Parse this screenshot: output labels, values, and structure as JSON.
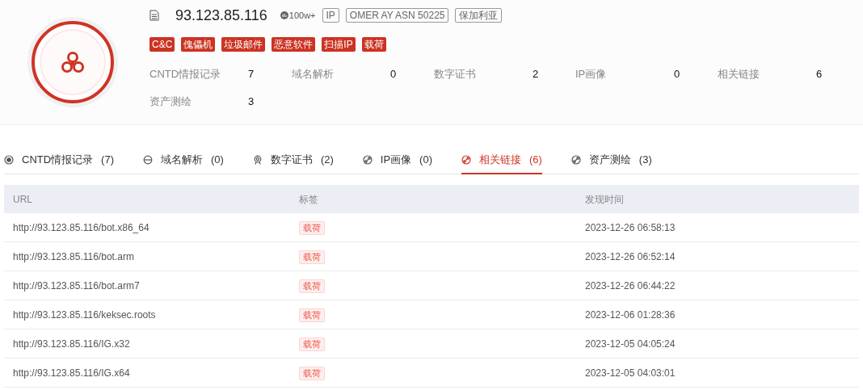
{
  "header": {
    "ip": "93.123.85.116",
    "heat": "100w+",
    "badges": [
      "IP",
      "OMER AY ASN 50225",
      "保加利亚"
    ],
    "threat_tags": [
      "C&C",
      "傀儡机",
      "垃圾邮件",
      "恶意软件",
      "扫描IP",
      "载荷"
    ],
    "stats": [
      {
        "label": "CNTD情报记录",
        "value": "7"
      },
      {
        "label": "域名解析",
        "value": "0"
      },
      {
        "label": "数字证书",
        "value": "2"
      },
      {
        "label": "IP画像",
        "value": "0"
      },
      {
        "label": "相关链接",
        "value": "6"
      },
      {
        "label": "资产测绘",
        "value": "3"
      }
    ]
  },
  "tabs": [
    {
      "label": "CNTD情报记录",
      "count": "(7)",
      "selected": false
    },
    {
      "label": "域名解析",
      "count": "(0)",
      "selected": false
    },
    {
      "label": "数字证书",
      "count": "(2)",
      "selected": false
    },
    {
      "label": "IP画像",
      "count": "(0)",
      "selected": false
    },
    {
      "label": "相关链接",
      "count": "(6)",
      "selected": true
    },
    {
      "label": "资产测绘",
      "count": "(3)",
      "selected": false
    }
  ],
  "table": {
    "columns": [
      "URL",
      "标签",
      "发现时间"
    ],
    "rows": [
      {
        "url": "http://93.123.85.116/bot.x86_64",
        "tag": "载荷",
        "time": "2023-12-26 06:58:13"
      },
      {
        "url": "http://93.123.85.116/bot.arm",
        "tag": "载荷",
        "time": "2023-12-26 06:52:14"
      },
      {
        "url": "http://93.123.85.116/bot.arm7",
        "tag": "载荷",
        "time": "2023-12-26 06:44:22"
      },
      {
        "url": "http://93.123.85.116/keksec.roots",
        "tag": "载荷",
        "time": "2023-12-06 01:28:36"
      },
      {
        "url": "http://93.123.85.116/IG.x32",
        "tag": "载荷",
        "time": "2023-12-05 04:05:24"
      },
      {
        "url": "http://93.123.85.116/IG.x64",
        "tag": "载荷",
        "time": "2023-12-05 04:03:01"
      }
    ]
  }
}
